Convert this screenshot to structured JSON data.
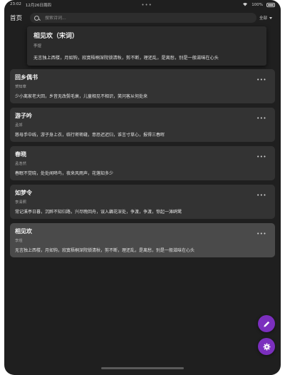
{
  "statusbar": {
    "time": "23:02",
    "date": "12月26日周四",
    "dots": "•••",
    "battery_pct": "100%"
  },
  "header": {
    "home_label": "首页",
    "search_placeholder": "搜索诗词...",
    "filter_label": "全部"
  },
  "overlay": {
    "title": "相见欢（宋词）",
    "author": "李煜",
    "content": "无言独上西楼，月如钩，寂寞梧桐深院锁清秋，剪不断，理还乱，是离愁，别是一般滋味在心头"
  },
  "poems": [
    {
      "title": "回乡偶书",
      "author": "贺知章",
      "content": "少小离家老大回，乡音无改鬓毛衰，儿童相见不相识，笑问客从何处来"
    },
    {
      "title": "游子吟",
      "author": "孟郊",
      "content": "慈母手中线，游子身上衣，临行密密缝，意恐迟迟归，谁言寸草心，报得三春晖"
    },
    {
      "title": "春晓",
      "author": "孟浩然",
      "content": "春眠不觉晓，处处闻啼鸟，夜来风雨声，花落知多少"
    },
    {
      "title": "如梦令",
      "author": "李清照",
      "content": "常记溪亭日暮，沉醉不知归路，兴尽晚回舟，误入藕花深处，争渡，争渡，惊起一滩鸥鹭"
    },
    {
      "title": "相见欢",
      "author": "李煜",
      "content": "无言独上西楼，月如钩，寂寞梧桐深院锁清秋，剪不断，理还乱，是离愁，别是一般滋味在心头"
    }
  ],
  "more_glyph": "•••",
  "colors": {
    "accent": "#7b2fbe",
    "background": "#1f1f1f",
    "card": "#333333",
    "card_selected": "#4a4a4a"
  },
  "icons": {
    "edit": "pencil-icon",
    "settings": "gear-icon",
    "search": "search-icon"
  }
}
